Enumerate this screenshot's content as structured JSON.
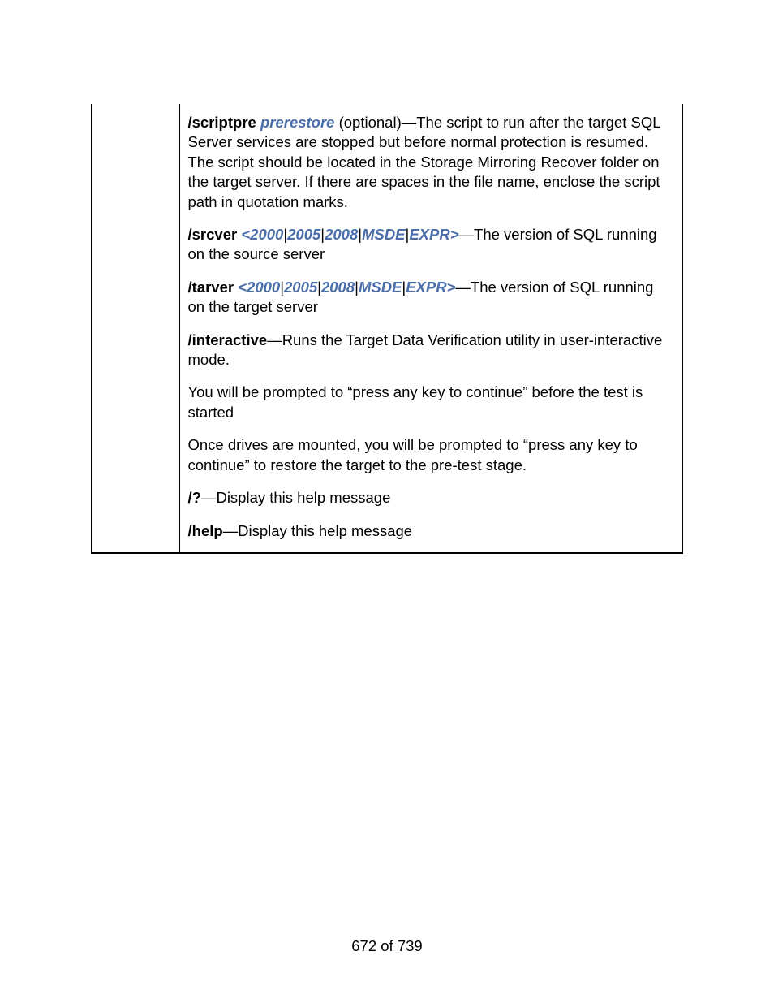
{
  "params": {
    "scriptpre": {
      "key_bold": "/scriptpre",
      "arg_ital": " prerestore",
      "rest": " (optional)—The script to run after the target SQL Server services are stopped but before normal protection is resumed. The script should be located in the Storage Mirroring Recover folder on the target server. If there are spaces in the file name, enclose the script path in quotation marks."
    },
    "srcver": {
      "key_bold": "/srcver ",
      "opt_open": "<",
      "o1": "2000",
      "o2": "2005",
      "o3": "2008",
      "o4": "MSDE",
      "o5": "EXPR",
      "opt_close": ">",
      "rest": "—The version of SQL running on the source server"
    },
    "tarver": {
      "key_bold": "/tarver ",
      "opt_open": "<",
      "o1": "2000",
      "o2": "2005",
      "o3": "2008",
      "o4": "MSDE",
      "o5": "EXPR",
      "opt_close": ">",
      "rest": "—The version of SQL running on the target server"
    },
    "interactive": {
      "key_bold": "/interactive",
      "rest": "—Runs the Target Data Verification utility in user-interactive mode."
    },
    "note1": "You will be prompted to “press any key to continue” before the test is started",
    "note2": "Once drives are mounted, you will be prompted to “press any key to continue” to restore the target to the pre-test stage.",
    "q": {
      "key_bold": "/?",
      "rest": "—Display this help message"
    },
    "help": {
      "key_bold": "/help",
      "rest": "—Display this help message"
    },
    "pipe": "|"
  },
  "footer": "672 of 739"
}
